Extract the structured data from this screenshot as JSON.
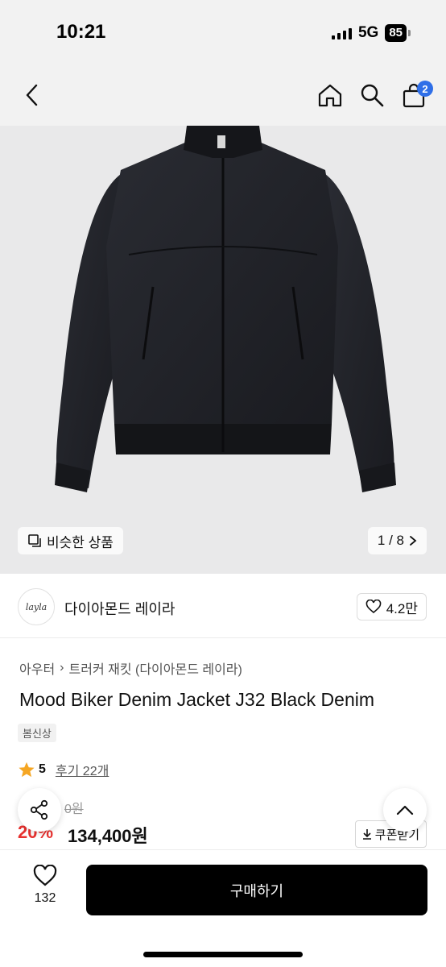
{
  "status_bar": {
    "time": "10:21",
    "network": "5G",
    "battery": "85",
    "icons": [
      "signal-icon",
      "battery-icon"
    ]
  },
  "header": {
    "cart_count": "2",
    "icons": [
      "back-arrow-icon",
      "home-icon",
      "search-icon",
      "cart-icon"
    ]
  },
  "gallery": {
    "similar_label": "비슷한 상품",
    "page_current": "1",
    "page_total": "8",
    "page_text": "1 / 8",
    "icons": [
      "similar-items-icon",
      "chevron-right-icon"
    ]
  },
  "brand": {
    "logo_text": "layla",
    "name": "다이아몬드 레이라",
    "likes": "4.2만"
  },
  "product": {
    "breadcrumb": [
      "아우터",
      "트러커 재킷 (다이아몬드 레이라)"
    ],
    "title": "Mood Biker Denim Jacket J32 Black Denim",
    "tag": "봄신상",
    "rating": "5",
    "reviews_label": "후기 22개",
    "original_price": "0원",
    "discount": "20%",
    "sale_price": "134,400원",
    "coupon_label": "쿠폰받기"
  },
  "bottom_bar": {
    "wish_count": "132",
    "buy_label": "구매하기"
  },
  "colors": {
    "accent_blue": "#2f6fe8",
    "discount_red": "#e8312f",
    "star": "#f5a623",
    "buy_button": "#000000"
  }
}
